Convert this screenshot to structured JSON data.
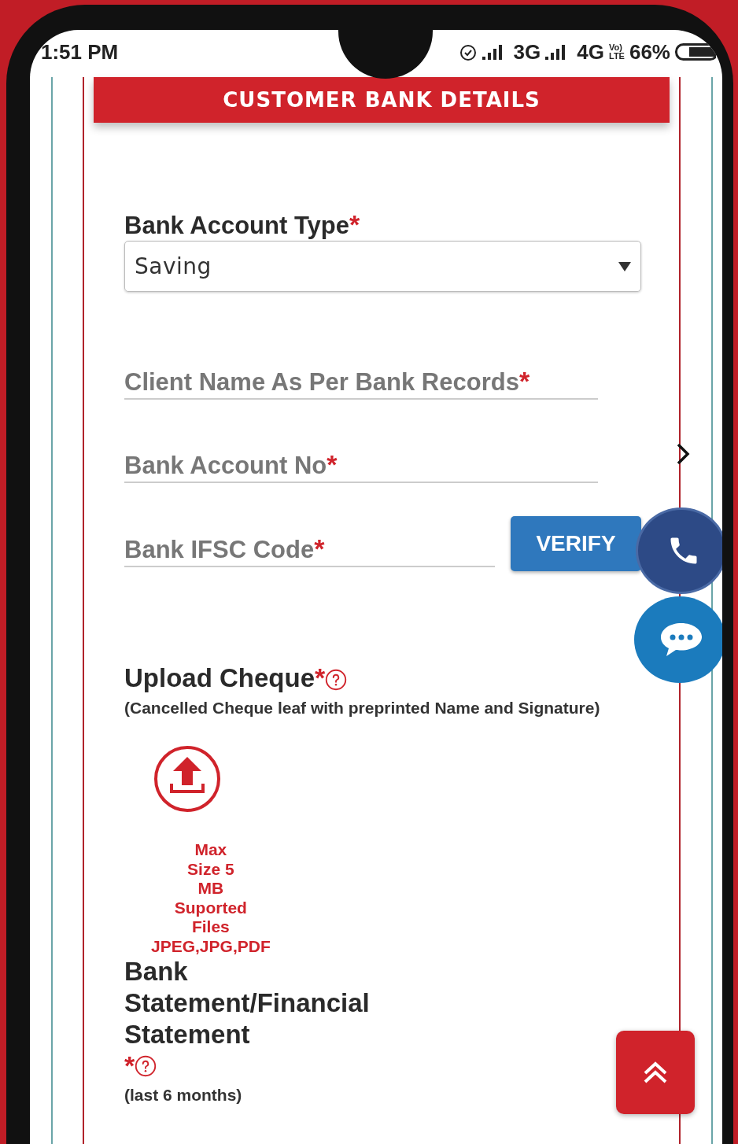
{
  "status_bar": {
    "time": "1:51 PM",
    "network_1": "3G",
    "network_2": "4G",
    "volte": [
      "Vo)",
      "LTE"
    ],
    "battery": "66%"
  },
  "header": {
    "title": "CUSTOMER BANK DETAILS"
  },
  "account_type": {
    "label": "Bank Account Type",
    "required_mark": "*",
    "value": "Saving"
  },
  "fields": [
    {
      "placeholder": "Client Name As Per Bank Records",
      "required_mark": "*"
    },
    {
      "placeholder": "Bank Account No",
      "required_mark": "*"
    },
    {
      "placeholder": "Bank IFSC Code",
      "required_mark": "*"
    }
  ],
  "verify_button": "VERIFY",
  "uploads": [
    {
      "title": "Upload Cheque",
      "required_mark": "*",
      "note": "(Cancelled Cheque leaf with preprinted Name and Signature)",
      "hint": "Max\nSize 5\nMB\nSuported\nFiles\nJPEG,JPG,PDF"
    },
    {
      "title": "Bank Statement/Financial Statement",
      "required_mark": "*",
      "note": "(last 6 months)"
    }
  ]
}
